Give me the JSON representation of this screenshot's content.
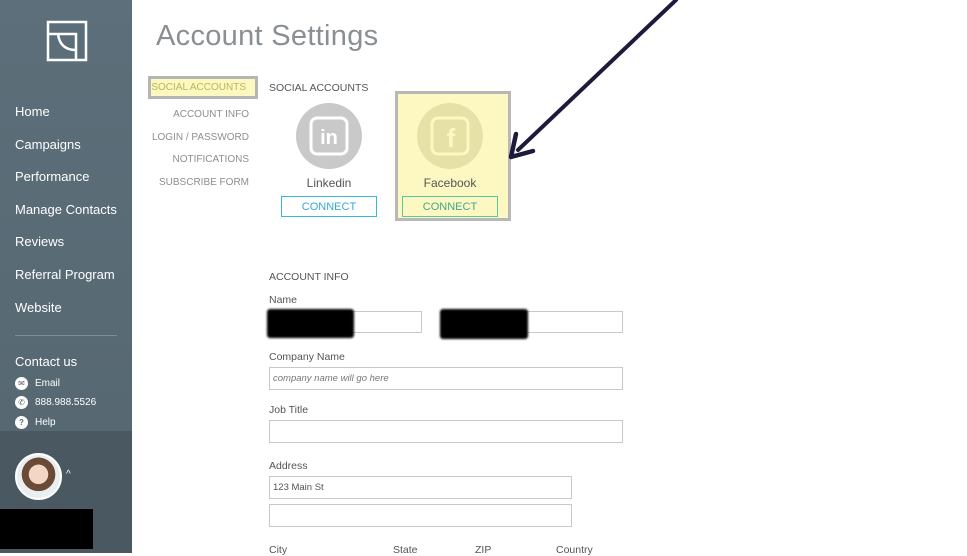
{
  "sidebar": {
    "nav": [
      "Home",
      "Campaigns",
      "Performance",
      "Manage Contacts",
      "Reviews",
      "Referral Program",
      "Website"
    ],
    "contact": {
      "title": "Contact us",
      "email": "Email",
      "phone": "888.988.5526",
      "help": "Help"
    }
  },
  "page": {
    "title": "Account Settings"
  },
  "subnav": [
    "SOCIAL ACCOUNTS",
    "ACCOUNT INFO",
    "LOGIN / PASSWORD",
    "NOTIFICATIONS",
    "SUBSCRIBE FORM"
  ],
  "social": {
    "heading": "SOCIAL ACCOUNTS",
    "linkedin": {
      "name": "Linkedin",
      "button": "CONNECT",
      "glyph": "in"
    },
    "facebook": {
      "name": "Facebook",
      "button": "CONNECT",
      "glyph": "f"
    }
  },
  "account_info": {
    "heading": "ACCOUNT INFO",
    "name_label": "Name",
    "company_label": "Company Name",
    "company_placeholder": "company name will go here",
    "job_label": "Job Title",
    "address_label": "Address",
    "address_line1": "123 Main St",
    "city_label": "City",
    "state_label": "State",
    "zip_label": "ZIP",
    "country_label": "Country"
  },
  "colors": {
    "sidebar": "#5c6f7a",
    "highlight": "#fdf8c2",
    "accent": "#35b7df",
    "arrow": "#1e1a3c"
  }
}
